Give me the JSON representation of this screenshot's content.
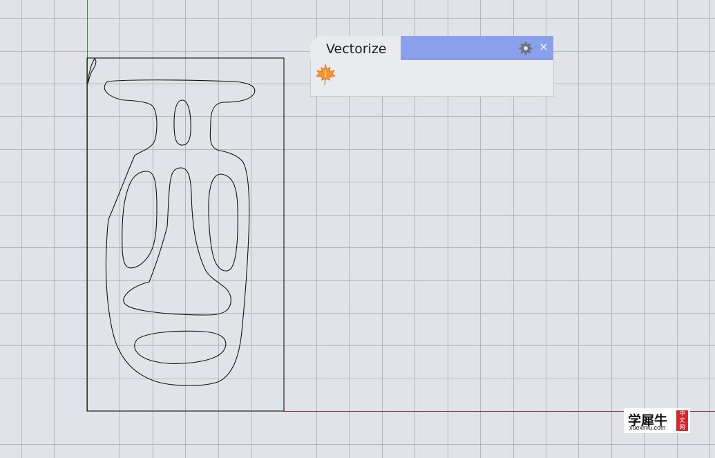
{
  "panel": {
    "tab_title": "Vectorize",
    "settings_icon": "gear-icon",
    "close_label": "×",
    "tools": [
      {
        "icon": "maple-leaf-icon",
        "color": "#f0962c"
      }
    ]
  },
  "viewport": {
    "background": "#e2e3e8",
    "grid_color": "#b4b6bc",
    "x_axis_color": "#9a2a2a",
    "y_axis_color": "#2f9a2f",
    "curve_color": "#111111"
  },
  "watermark": {
    "chinese_text": "学犀牛",
    "url_text": "xuexiniu.com",
    "badge_chars": [
      "中",
      "文",
      "网"
    ]
  }
}
